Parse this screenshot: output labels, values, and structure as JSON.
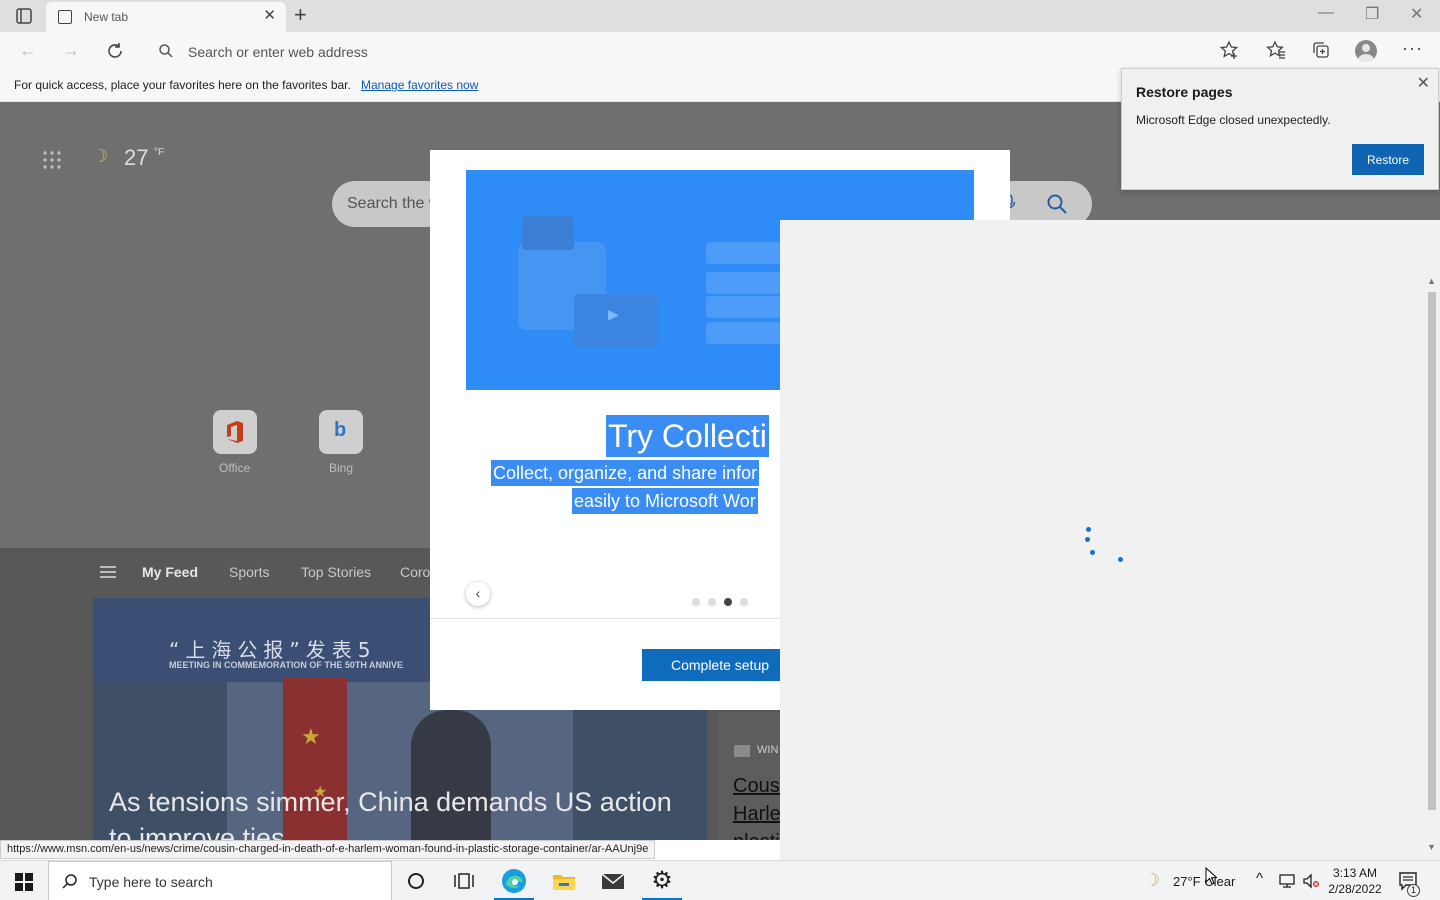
{
  "browser": {
    "tab_title": "New tab",
    "address_placeholder": "Search or enter web address",
    "favorites_message": "For quick access, place your favorites here on the favorites bar.",
    "favorites_link": "Manage favorites now"
  },
  "newtab_page": {
    "weather_temp": "27",
    "weather_unit": "°F",
    "search_placeholder": "Search the w",
    "quick_links": [
      {
        "label": "Office"
      },
      {
        "label": "Bing"
      }
    ],
    "feed_tabs": [
      "My Feed",
      "Sports",
      "Top Stories",
      "Coro"
    ],
    "hero": {
      "chinese_title": "“上海公报”发表5",
      "subtitle": "MEETING IN COMMEMORATION OF THE 50TH ANNIVE",
      "headline": "As tensions simmer, China demands US action to improve ties"
    },
    "side_card": {
      "source": "WIN",
      "lines": [
        "Cous",
        "Harle",
        "plasti"
      ]
    },
    "status_url": "https://www.msn.com/en-us/news/crime/cousin-charged-in-death-of-e-harlem-woman-found-in-plastic-storage-container/ar-AAUnj9e"
  },
  "restore_popup": {
    "title": "Restore pages",
    "message": "Microsoft Edge closed unexpectedly.",
    "button": "Restore"
  },
  "setup_dialog": {
    "headline": "Try Collecti",
    "description_line1": "Collect, organize, and share infor",
    "description_line2": "easily to Microsoft Wor",
    "page_count": 4,
    "current_page": 3,
    "cta": "Complete setup",
    "accent": "#0f6cbd"
  },
  "taskbar": {
    "search_placeholder": "Type here to search",
    "weather": "27°F Clear",
    "time": "3:13 AM",
    "date": "2/28/2022",
    "notification_count": "1"
  }
}
